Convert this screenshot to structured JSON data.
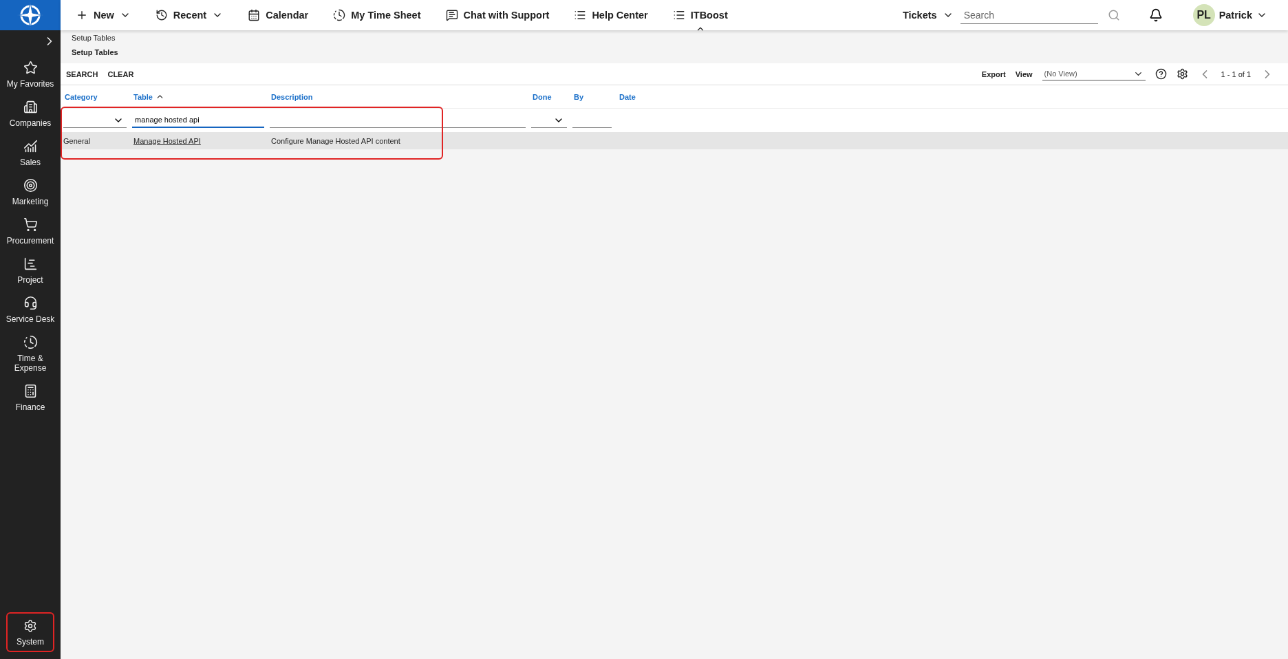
{
  "top_nav": {
    "items": [
      {
        "label": "New",
        "dropdown": true
      },
      {
        "label": "Recent",
        "dropdown": true
      },
      {
        "label": "Calendar",
        "dropdown": false
      },
      {
        "label": "My Time Sheet",
        "dropdown": false
      },
      {
        "label": "Chat with Support",
        "dropdown": false
      },
      {
        "label": "Help Center",
        "dropdown": false
      },
      {
        "label": "ITBoost",
        "dropdown": false
      }
    ],
    "search_scope": "Tickets",
    "search": {
      "placeholder": "Search"
    },
    "user": {
      "initials": "PL",
      "name": "Patrick"
    }
  },
  "sidebar": {
    "items": [
      {
        "label": "My Favorites",
        "highlighted": false
      },
      {
        "label": "Companies",
        "highlighted": false
      },
      {
        "label": "Sales",
        "highlighted": false
      },
      {
        "label": "Marketing",
        "highlighted": false
      },
      {
        "label": "Procurement",
        "highlighted": false
      },
      {
        "label": "Project",
        "highlighted": false
      },
      {
        "label": "Service Desk",
        "highlighted": false
      },
      {
        "label": "Time & Expense",
        "highlighted": false
      },
      {
        "label": "Finance",
        "highlighted": false
      }
    ],
    "bottom_item": {
      "label": "System",
      "highlighted": true
    }
  },
  "breadcrumb": "Setup Tables",
  "page_title": "Setup Tables",
  "toolbar": {
    "actions": [
      "SEARCH",
      "CLEAR"
    ],
    "export": "Export",
    "view_label": "View",
    "view_value": "(No View)",
    "pager": "1 - 1 of 1"
  },
  "table": {
    "columns": [
      {
        "label": "Category",
        "sorted": false,
        "kind": "select"
      },
      {
        "label": "Table",
        "sorted": true,
        "kind": "text",
        "filter_value": "manage hosted api"
      },
      {
        "label": "Description",
        "sorted": false,
        "kind": "text"
      },
      {
        "label": "Done",
        "sorted": false,
        "kind": "select"
      },
      {
        "label": "By",
        "sorted": false,
        "kind": "text"
      },
      {
        "label": "Date",
        "sorted": false,
        "kind": "none"
      }
    ],
    "rows": [
      {
        "cells": [
          "General",
          "Manage Hosted API",
          "Configure Manage Hosted API content"
        ],
        "highlighted": true
      }
    ],
    "filter_highlighted": true
  }
}
